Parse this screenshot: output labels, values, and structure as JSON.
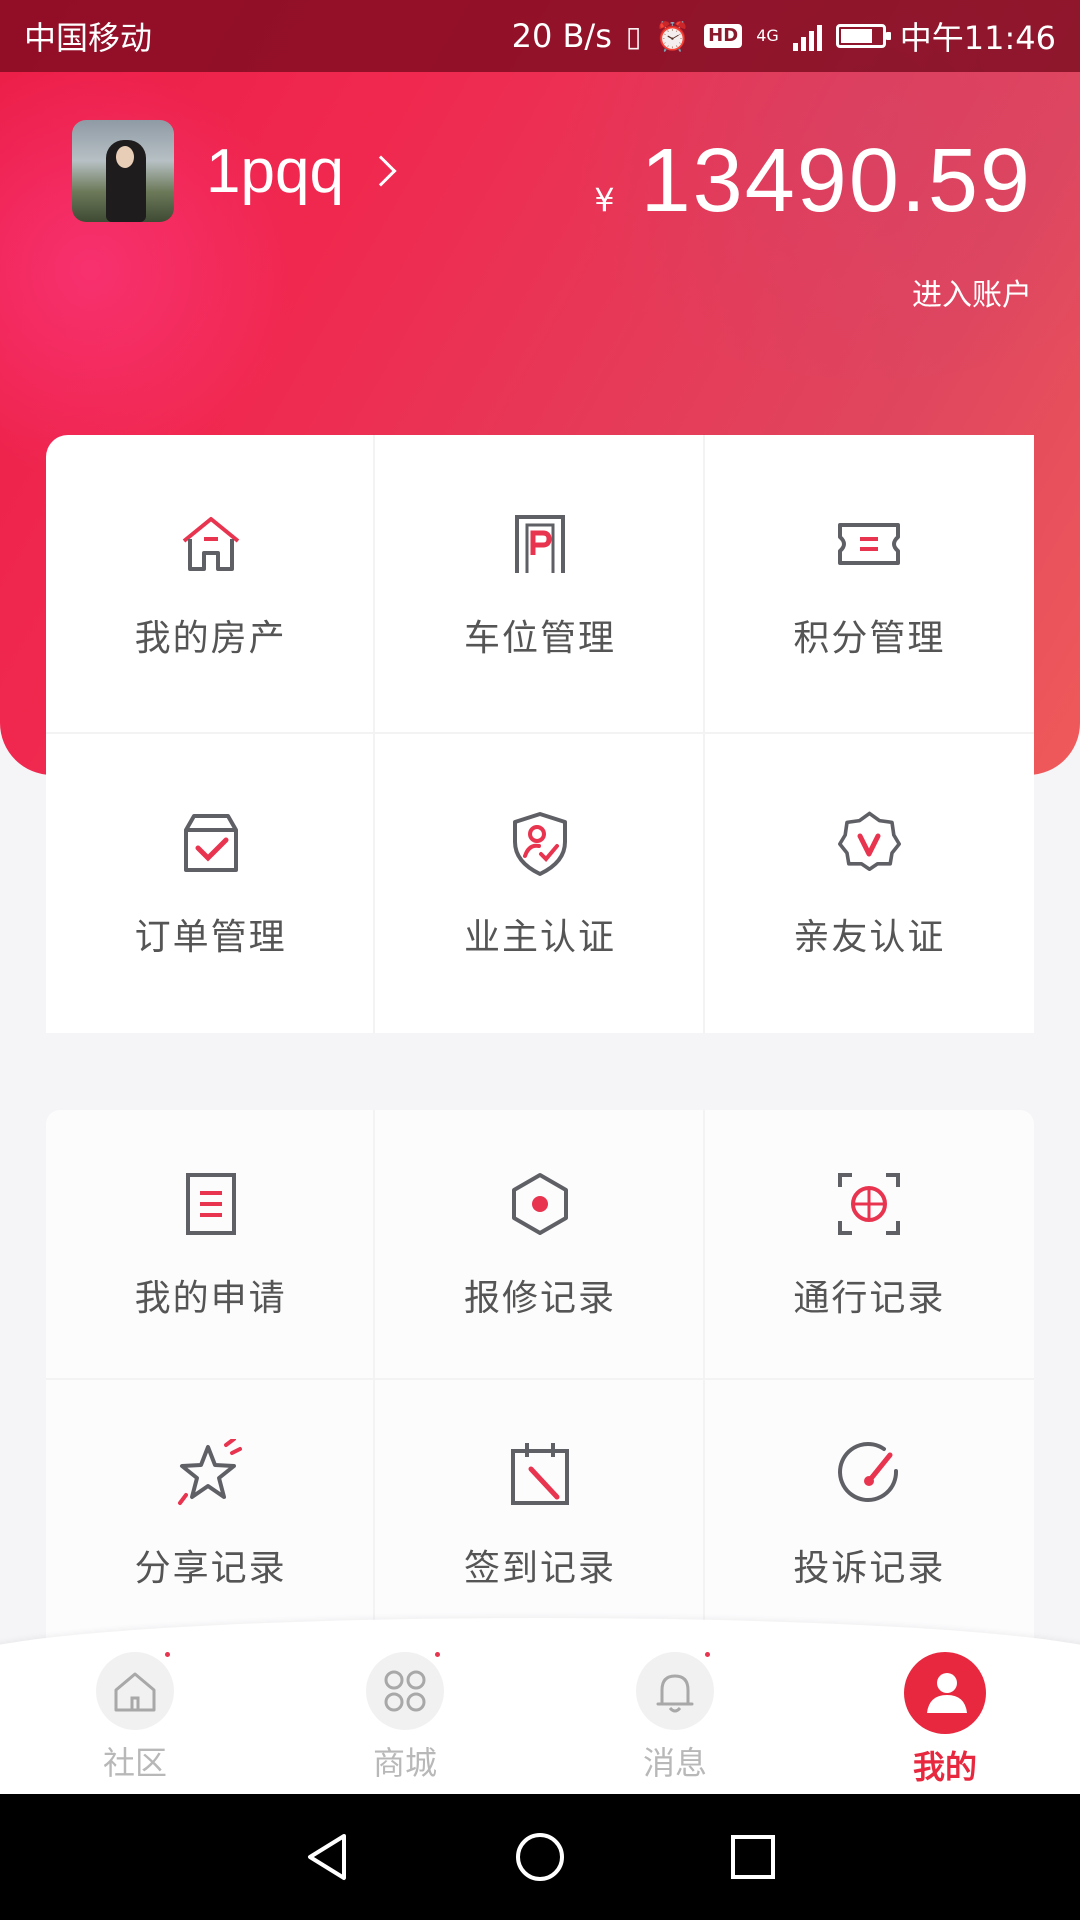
{
  "status_bar": {
    "carrier": "中国移动",
    "speed": "20 B/s",
    "hd": "HD",
    "network": "4G",
    "time": "中午11:46"
  },
  "profile": {
    "username": "1pqq",
    "currency_symbol": "¥",
    "balance": "13490.59",
    "account_link": "进入账户"
  },
  "card1": {
    "items": [
      {
        "label": "我的房产",
        "icon": "house-icon"
      },
      {
        "label": "车位管理",
        "icon": "parking-icon"
      },
      {
        "label": "积分管理",
        "icon": "ticket-icon"
      },
      {
        "label": "订单管理",
        "icon": "order-box-icon"
      },
      {
        "label": "业主认证",
        "icon": "shield-user-icon"
      },
      {
        "label": "亲友认证",
        "icon": "badge-v-icon"
      }
    ]
  },
  "card2": {
    "items": [
      {
        "label": "我的申请",
        "icon": "document-icon"
      },
      {
        "label": "报修记录",
        "icon": "hexagon-dot-icon"
      },
      {
        "label": "通行记录",
        "icon": "scan-globe-icon"
      },
      {
        "label": "分享记录",
        "icon": "star-icon"
      },
      {
        "label": "签到记录",
        "icon": "calendar-check-icon"
      },
      {
        "label": "投诉记录",
        "icon": "gauge-icon"
      }
    ]
  },
  "tabbar": {
    "tabs": [
      {
        "label": "社区",
        "icon": "home-icon",
        "active": false
      },
      {
        "label": "商城",
        "icon": "grid-icon",
        "active": false
      },
      {
        "label": "消息",
        "icon": "bell-icon",
        "active": false
      },
      {
        "label": "我的",
        "icon": "user-icon",
        "active": true
      }
    ]
  },
  "colors": {
    "accent": "#e8283f",
    "icon_gray": "#5f5f66",
    "label_gray": "#555555"
  }
}
